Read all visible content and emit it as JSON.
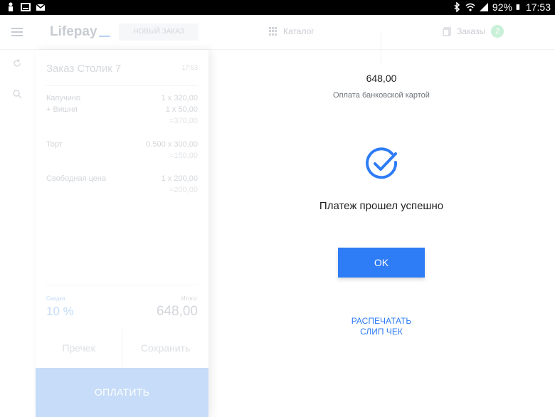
{
  "status_bar": {
    "battery": "92%",
    "time": "17:53"
  },
  "header": {
    "logo": "Lifepay",
    "new_order_label": "НОВЫЙ ЗАКАЗ",
    "catalog_label": "Каталог",
    "orders_label": "Заказы",
    "orders_count": "2"
  },
  "order": {
    "title": "Заказ Столик 7",
    "time": "17:53",
    "items": [
      {
        "name": "Капучино",
        "qty": "1 х 320,00"
      },
      {
        "name": "+ Вишня",
        "qty": "1 х 50,00",
        "sum": "=370,00"
      },
      {
        "name": "Торт",
        "qty": "0.500 х 300,00",
        "sum": "=150,00"
      },
      {
        "name": "Свободная цена",
        "qty": "1 х 200,00",
        "sum": "=200,00"
      }
    ],
    "discount_label": "Скидка",
    "discount_value": "10 %",
    "total_label": "Итого:",
    "total_value": "648,00",
    "precheck_label": "Пречек",
    "save_label": "Сохранить",
    "pay_label": "ОПЛАТИТЬ"
  },
  "payment": {
    "amount": "648,00",
    "method": "Оплата банковской картой",
    "success_message": "Платеж прошел успешно",
    "ok_label": "OK",
    "print_line1": "РАСПЕЧАТАТЬ",
    "print_line2": "СЛИП ЧЕК"
  },
  "colors": {
    "accent": "#2e7cf6",
    "statusbar": "#000000"
  }
}
